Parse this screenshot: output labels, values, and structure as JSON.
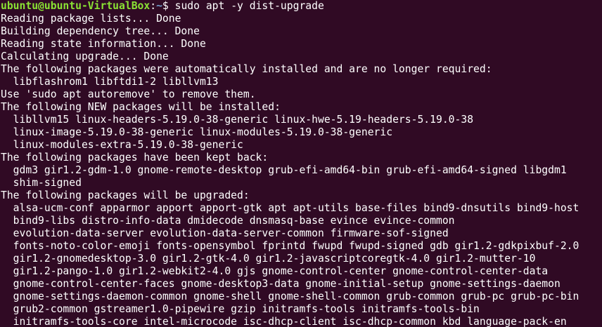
{
  "prompt": {
    "user_host": "ubuntu@ubuntu-VirtualBox",
    "colon": ":",
    "path": "~",
    "symbol": "$ ",
    "command": "sudo apt -y dist-upgrade"
  },
  "output_lines": [
    "Reading package lists... Done",
    "Building dependency tree... Done",
    "Reading state information... Done",
    "Calculating upgrade... Done",
    "The following packages were automatically installed and are no longer required:",
    "  libflashrom1 libftdi1-2 libllvm13",
    "Use 'sudo apt autoremove' to remove them.",
    "The following NEW packages will be installed:",
    "  libllvm15 linux-headers-5.19.0-38-generic linux-hwe-5.19-headers-5.19.0-38",
    "  linux-image-5.19.0-38-generic linux-modules-5.19.0-38-generic",
    "  linux-modules-extra-5.19.0-38-generic",
    "The following packages have been kept back:",
    "  gdm3 gir1.2-gdm-1.0 gnome-remote-desktop grub-efi-amd64-bin grub-efi-amd64-signed libgdm1",
    "  shim-signed",
    "The following packages will be upgraded:",
    "  alsa-ucm-conf apparmor apport apport-gtk apt apt-utils base-files bind9-dnsutils bind9-host",
    "  bind9-libs distro-info-data dmidecode dnsmasq-base evince evince-common",
    "  evolution-data-server evolution-data-server-common firmware-sof-signed",
    "  fonts-noto-color-emoji fonts-opensymbol fprintd fwupd fwupd-signed gdb gir1.2-gdkpixbuf-2.0",
    "  gir1.2-gnomedesktop-3.0 gir1.2-gtk-4.0 gir1.2-javascriptcoregtk-4.0 gir1.2-mutter-10",
    "  gir1.2-pango-1.0 gir1.2-webkit2-4.0 gjs gnome-control-center gnome-control-center-data",
    "  gnome-control-center-faces gnome-desktop3-data gnome-initial-setup gnome-settings-daemon",
    "  gnome-settings-daemon-common gnome-shell gnome-shell-common grub-common grub-pc grub-pc-bin",
    "  grub2-common gstreamer1.0-pipewire gzip initramfs-tools initramfs-tools-bin",
    "  initramfs-tools-core intel-microcode isc-dhcp-client isc-dhcp-common kbd language-pack-en"
  ],
  "colors": {
    "background": "#300a24",
    "foreground": "#ffffff",
    "prompt_user": "#8ae234",
    "prompt_path": "#729fcf"
  }
}
